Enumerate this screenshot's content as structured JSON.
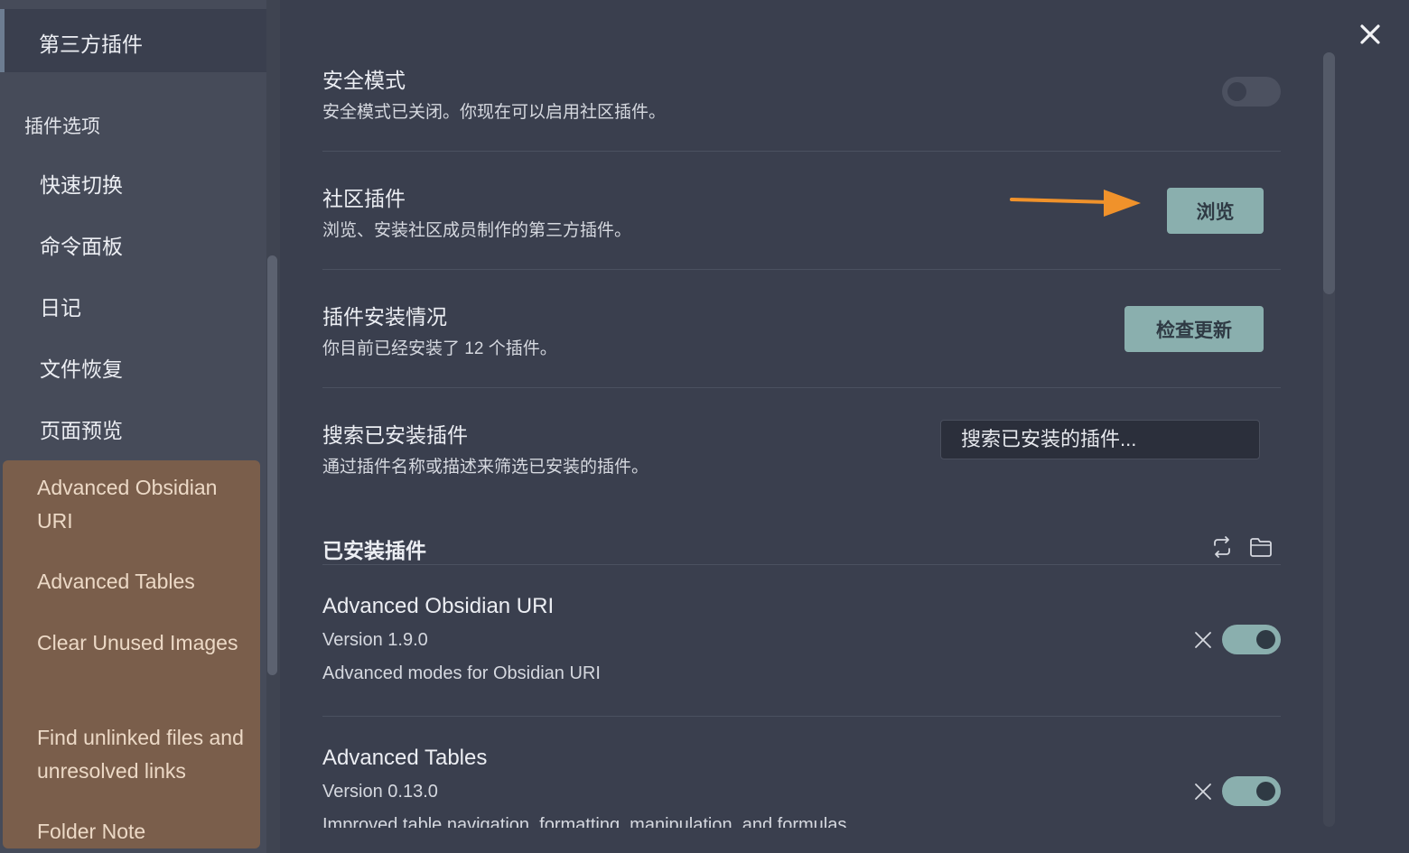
{
  "sidebar": {
    "active_item": "第三方插件",
    "heading": "插件选项",
    "items": [
      "快速切换",
      "命令面板",
      "日记",
      "文件恢复",
      "页面预览"
    ],
    "plugins": [
      "Advanced Obsidian URI",
      "Advanced Tables",
      "Clear Unused Images",
      "Find unlinked files and unresolved links",
      "Folder Note"
    ]
  },
  "settings": {
    "safe_mode": {
      "title": "安全模式",
      "desc": "安全模式已关闭。你现在可以启用社区插件。",
      "enabled": false
    },
    "community": {
      "title": "社区插件",
      "desc": "浏览、安装社区成员制作的第三方插件。",
      "button": "浏览"
    },
    "installed_status": {
      "title": "插件安装情况",
      "desc": "你目前已经安装了 12 个插件。",
      "button": "检查更新"
    },
    "search": {
      "title": "搜索已安装插件",
      "desc": "通过插件名称或描述来筛选已安装的插件。",
      "placeholder": "搜索已安装的插件..."
    }
  },
  "installed": {
    "title": "已安装插件",
    "plugins": [
      {
        "name": "Advanced Obsidian URI",
        "version": "Version 1.9.0",
        "desc": "Advanced modes for Obsidian URI",
        "enabled": true
      },
      {
        "name": "Advanced Tables",
        "version": "Version 0.13.0",
        "desc": "Improved table navigation, formatting, manipulation, and formulas",
        "enabled": true
      }
    ]
  },
  "colors": {
    "accent": "#8aafae",
    "arrow": "#f0922b",
    "plugin_highlight": "#7a5e4b"
  }
}
